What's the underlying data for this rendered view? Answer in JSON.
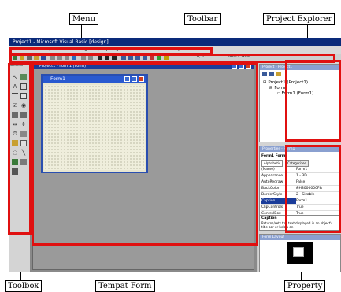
{
  "annotations": {
    "menu": "Menu",
    "toolbar": "Toolbar",
    "project_explorer": "Project Explorer",
    "toolbox": "Toolbox",
    "tempat_form": "Tempat Form",
    "property": "Property"
  },
  "window": {
    "title": "Project1 - Microsoft Visual Basic [design]"
  },
  "menu": {
    "items": [
      "File",
      "Edit",
      "View",
      "Project",
      "Format",
      "Debug",
      "Run",
      "Query",
      "Diagram",
      "Tools",
      "Add-Ins",
      "Window",
      "Help"
    ]
  },
  "toolbar": {
    "position_readout": "0, 0",
    "size_readout": "4800 x 3600"
  },
  "toolbox": {
    "title": "General"
  },
  "project_window": {
    "title": "Project1 - Form1 (Form)"
  },
  "form": {
    "title": "Form1"
  },
  "project_explorer": {
    "title": "Project - Project1",
    "tree": {
      "project": "Project1 (Project1)",
      "folder": "Forms",
      "form": "Form1 (Form1)"
    }
  },
  "properties": {
    "title": "Properties - Form1",
    "object": "Form1  Form",
    "tabs": [
      "Alphabetic",
      "Categorized"
    ],
    "rows": [
      {
        "name": "(Name)",
        "value": "Form1"
      },
      {
        "name": "Appearance",
        "value": "1 - 3D"
      },
      {
        "name": "AutoRedraw",
        "value": "False"
      },
      {
        "name": "BackColor",
        "value": "&H8000000F&"
      },
      {
        "name": "BorderStyle",
        "value": "2 - Sizable"
      },
      {
        "name": "Caption",
        "value": "Form1"
      },
      {
        "name": "ClipControls",
        "value": "True"
      },
      {
        "name": "ControlBox",
        "value": "True"
      },
      {
        "name": "DrawMode",
        "value": "13 - Copy Pen"
      }
    ],
    "desc_title": "Caption",
    "desc_text": "Returns/sets the text displayed in an object's title bar or below an"
  },
  "form_layout": {
    "title": "Form Layout"
  },
  "colors": {
    "callout_red": "#e01010",
    "title_blue": "#0a2a7a",
    "form_blue": "#2a5ad0"
  }
}
